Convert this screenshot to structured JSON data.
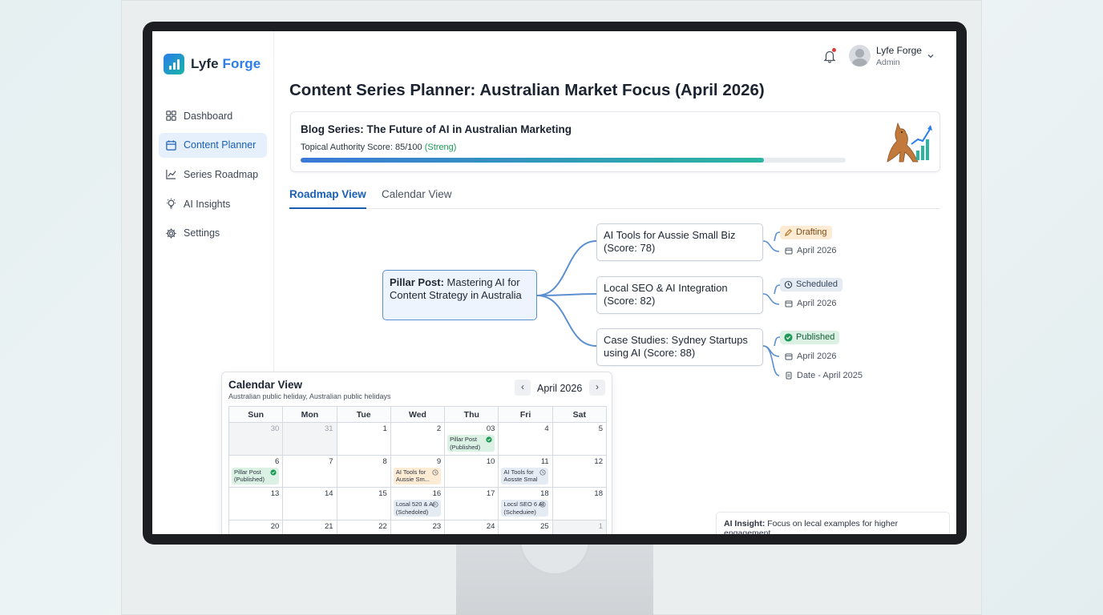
{
  "app": {
    "logo_text": "Lyfe ",
    "logo_accent": "Forge"
  },
  "sidebar": {
    "items": [
      {
        "label": "Dashboard",
        "icon": "grid-icon",
        "active": false
      },
      {
        "label": "Content Planner",
        "icon": "calendar-icon",
        "active": true
      },
      {
        "label": "Series Roadmap",
        "icon": "trend-chart-icon",
        "active": false
      },
      {
        "label": "AI Insights",
        "icon": "lightbulb-icon",
        "active": false
      },
      {
        "label": "Settings",
        "icon": "gear-icon",
        "active": false
      }
    ]
  },
  "header": {
    "user_name": "Lyfe Forge",
    "user_role": "Admin"
  },
  "page": {
    "title": "Content Series Planner: Australian Market Focus (April 2026)"
  },
  "series": {
    "title": "Blog Series: The Future of AI in Australian Marketing",
    "score_label": "Topical Authority Score: 85/100 ",
    "score_strength": "(Streng)",
    "progress": 0.85
  },
  "tabs": [
    {
      "label": "Roadmap View",
      "active": true
    },
    {
      "label": "Calendar View",
      "active": false
    }
  ],
  "roadmap": {
    "pillar": {
      "prefix": "Pillar Post:",
      "text": " Mastering AI for Content Strategy in Australia"
    },
    "children": [
      {
        "title": "AI Tools for Aussie Small Biz (Score: 78)",
        "status": "Drafting",
        "date": "April 2026"
      },
      {
        "title": "Local SEO & AI Integration (Score: 82)",
        "status": "Scheduled",
        "date": "April 2026"
      },
      {
        "title": "Case Studies: Sydney Startups using AI (Score: 88)",
        "status": "Published",
        "date": "April 2026",
        "extra": "Date - April 2025"
      }
    ]
  },
  "calendar": {
    "title": "Calendar View",
    "subtitle": "Australian public heliday, Australian public helidays",
    "month": "April 2026",
    "prev": "‹",
    "next": "›",
    "weekdays": [
      "Sun",
      "Mon",
      "Tue",
      "Wed",
      "Thu",
      "Fri",
      "Sat"
    ],
    "weeks": [
      [
        {
          "d": "30",
          "muted": true
        },
        {
          "d": "31",
          "muted": true
        },
        {
          "d": "1"
        },
        {
          "d": "2"
        },
        {
          "d": "03",
          "ev": {
            "text": "Pillar Post (Published)",
            "kind": "pub"
          }
        },
        {
          "d": "4"
        },
        {
          "d": "5"
        }
      ],
      [
        {
          "d": "6",
          "ev": {
            "text": "Pillar Post (Published)",
            "kind": "pub"
          }
        },
        {
          "d": "7"
        },
        {
          "d": "8"
        },
        {
          "d": "9",
          "ev": {
            "text": "AI Tools for Aussie Sm...",
            "kind": "draft"
          }
        },
        {
          "d": "10"
        },
        {
          "d": "11",
          "ev": {
            "text": "AI Tools for Aosste Smal",
            "kind": "sched"
          }
        },
        {
          "d": "12"
        }
      ],
      [
        {
          "d": "13"
        },
        {
          "d": "14"
        },
        {
          "d": "15"
        },
        {
          "d": "16",
          "ev": {
            "text": "Losal 520 & AI (Schedoled)",
            "kind": "sched"
          }
        },
        {
          "d": "17"
        },
        {
          "d": "18",
          "ev": {
            "text": "Locsl SEO 6 AI (Scheduiee)",
            "kind": "sched"
          }
        },
        {
          "d": "18"
        }
      ],
      [
        {
          "d": "20"
        },
        {
          "d": "21"
        },
        {
          "d": "22"
        },
        {
          "d": "23"
        },
        {
          "d": "24"
        },
        {
          "d": "25"
        },
        {
          "d": "1",
          "muted": true
        }
      ]
    ]
  },
  "insight": {
    "label": "AI Insight:",
    "text": " Focus on lecal examples for higher engagement."
  },
  "colors": {
    "accent": "#1a5fb4",
    "success": "#1e9a57",
    "draft": "#fdebd3"
  }
}
